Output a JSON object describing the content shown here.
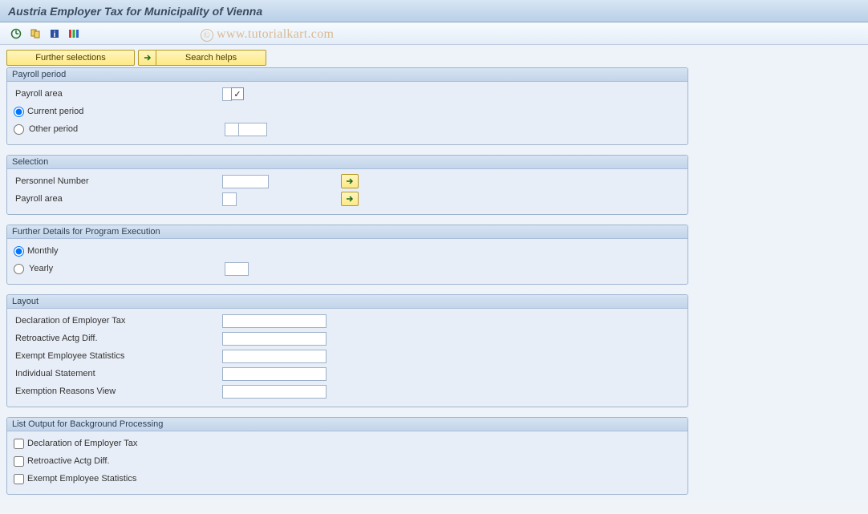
{
  "title": "Austria Employer Tax for Municipality of Vienna",
  "watermark": "www.tutorialkart.com",
  "toolbar": {
    "icons": [
      "execute",
      "variant",
      "info",
      "color-legend"
    ]
  },
  "actions": {
    "further_selections": "Further selections",
    "search_helps": "Search helps"
  },
  "sections": {
    "payroll_period": {
      "title": "Payroll period",
      "payroll_area_label": "Payroll area",
      "payroll_area_checked": true,
      "current_period": "Current period",
      "other_period": "Other period",
      "selected": "current",
      "other_val1": "",
      "other_val2": ""
    },
    "selection": {
      "title": "Selection",
      "personnel_number_label": "Personnel Number",
      "personnel_number": "",
      "payroll_area_label": "Payroll area",
      "payroll_area": ""
    },
    "further_details": {
      "title": "Further Details for Program Execution",
      "monthly": "Monthly",
      "yearly": "Yearly",
      "selected": "monthly",
      "yearly_val": ""
    },
    "layout": {
      "title": "Layout",
      "fields": [
        {
          "label": "Declaration of Employer Tax",
          "value": ""
        },
        {
          "label": "Retroactive Actg Diff.",
          "value": ""
        },
        {
          "label": "Exempt Employee Statistics",
          "value": ""
        },
        {
          "label": "Individual Statement",
          "value": ""
        },
        {
          "label": "Exemption Reasons View",
          "value": ""
        }
      ]
    },
    "list_output": {
      "title": "List Output for Background Processing",
      "items": [
        {
          "label": "Declaration of Employer Tax",
          "checked": false
        },
        {
          "label": "Retroactive Actg Diff.",
          "checked": false
        },
        {
          "label": "Exempt Employee Statistics",
          "checked": false
        }
      ]
    }
  }
}
